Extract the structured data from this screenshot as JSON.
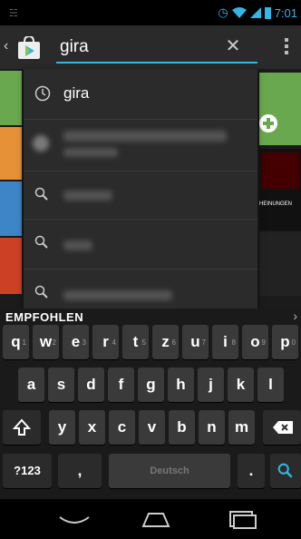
{
  "status_bar": {
    "time": "7:01"
  },
  "search": {
    "query": "gira"
  },
  "suggestions": [
    {
      "text": "gira",
      "type": "history"
    },
    {
      "text": "",
      "type": "app"
    },
    {
      "text": "",
      "type": "search"
    },
    {
      "text": "",
      "type": "search"
    },
    {
      "text": "",
      "type": "search"
    }
  ],
  "background": {
    "section_label": "EMPFOHLEN",
    "promo_text": "HEINUNGEN"
  },
  "keyboard": {
    "row1": [
      "q",
      "w",
      "e",
      "r",
      "t",
      "z",
      "u",
      "i",
      "o",
      "p"
    ],
    "row1_sub": [
      "1",
      "2",
      "3",
      "4",
      "5",
      "6",
      "7",
      "8",
      "9",
      "0"
    ],
    "row2": [
      "a",
      "s",
      "d",
      "f",
      "g",
      "h",
      "j",
      "k",
      "l"
    ],
    "row3": [
      "y",
      "x",
      "c",
      "v",
      "b",
      "n",
      "m"
    ],
    "symbols_label": "?123",
    "comma": ",",
    "period": ".",
    "space_label": "Deutsch"
  },
  "colors": {
    "accent": "#33b5e5",
    "key": "#3a3a3a"
  }
}
